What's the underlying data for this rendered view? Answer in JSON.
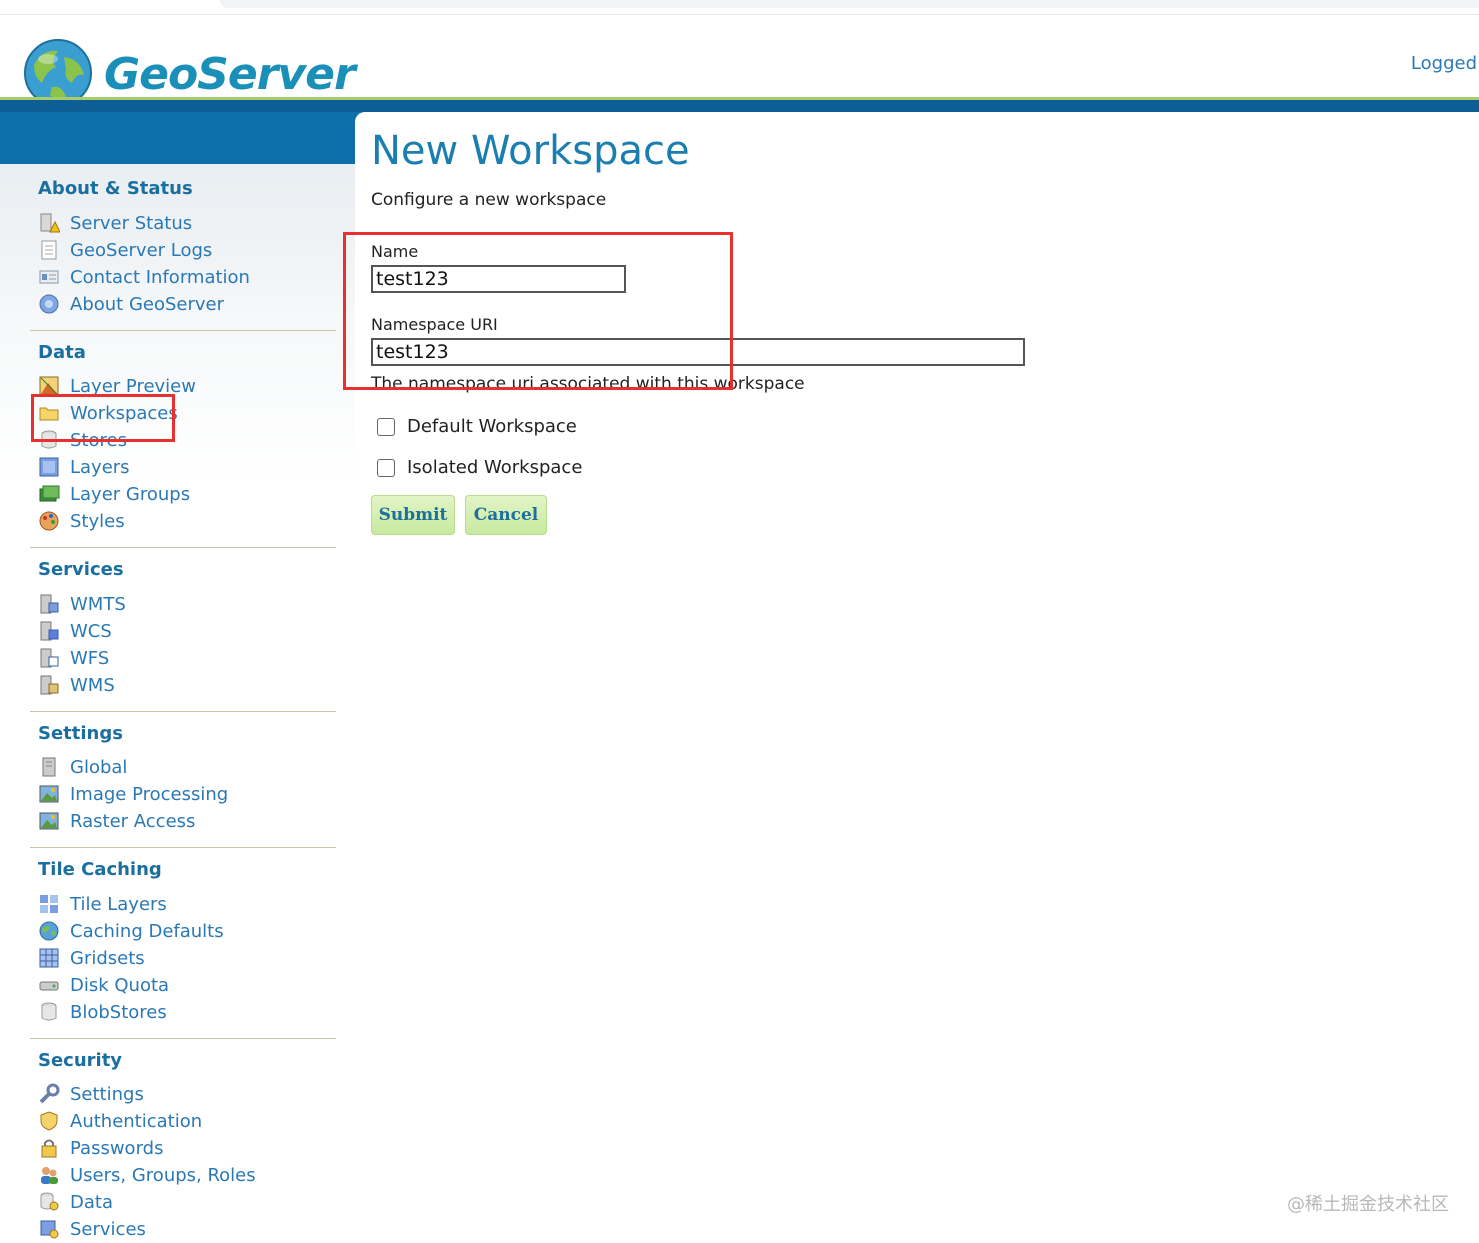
{
  "header": {
    "brand": "GeoServer",
    "logged": "Logged"
  },
  "sidebar": {
    "sections": [
      {
        "title": "About & Status",
        "items": [
          "Server Status",
          "GeoServer Logs",
          "Contact Information",
          "About GeoServer"
        ]
      },
      {
        "title": "Data",
        "items": [
          "Layer Preview",
          "Workspaces",
          "Stores",
          "Layers",
          "Layer Groups",
          "Styles"
        ]
      },
      {
        "title": "Services",
        "items": [
          "WMTS",
          "WCS",
          "WFS",
          "WMS"
        ]
      },
      {
        "title": "Settings",
        "items": [
          "Global",
          "Image Processing",
          "Raster Access"
        ]
      },
      {
        "title": "Tile Caching",
        "items": [
          "Tile Layers",
          "Caching Defaults",
          "Gridsets",
          "Disk Quota",
          "BlobStores"
        ]
      },
      {
        "title": "Security",
        "items": [
          "Settings",
          "Authentication",
          "Passwords",
          "Users, Groups, Roles",
          "Data",
          "Services"
        ]
      }
    ]
  },
  "form": {
    "title": "New Workspace",
    "subtitle": "Configure a new workspace",
    "name_label": "Name",
    "name_value": "test123",
    "uri_label": "Namespace URI",
    "uri_value": "test123",
    "uri_hint": "The namespace uri associated with this workspace",
    "default_label": "Default Workspace",
    "isolated_label": "Isolated Workspace",
    "submit_label": "Submit",
    "cancel_label": "Cancel"
  },
  "watermark": "@稀土掘金技术社区",
  "colors": {
    "accent_blue": "#0f6fa8",
    "link_blue": "#2a78b5",
    "highlight_red": "#e8312f",
    "button_green": "#c8eaa0"
  }
}
